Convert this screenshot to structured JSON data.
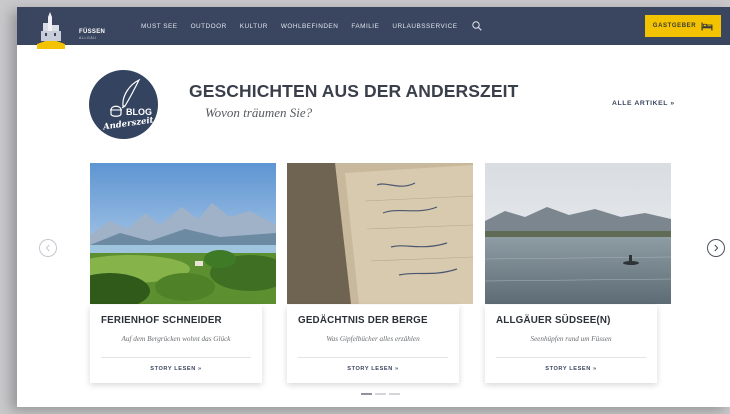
{
  "nav": {
    "logo_text": "FÜSSEN",
    "logo_sub": "ALLGÄU",
    "items": [
      "MUST SEE",
      "OUTDOOR",
      "KULTUR",
      "WOHLBEFINDEN",
      "FAMILIE",
      "URLAUBSSERVICE"
    ],
    "search_icon": "search-icon",
    "host_button": "GASTGEBER",
    "host_icon": "bed-icon"
  },
  "header": {
    "badge_word": "BLOG",
    "badge_script": "Anderszeit",
    "title": "GESCHICHTEN AUS DER ANDERSZEIT",
    "subtitle": "Wovon träumen Sie?",
    "all_articles": "ALLE ARTIKEL  »"
  },
  "cards": [
    {
      "title": "FERIENHOF SCHNEIDER",
      "description": "Auf dem Bergrücken wohnt das Glück",
      "button": "STORY LESEN  »"
    },
    {
      "title": "GEDÄCHTNIS DER BERGE",
      "description": "Was Gipfelbücher alles erzählen",
      "button": "STORY LESEN  »"
    },
    {
      "title": "ALLGÄUER SÜDSEE(N)",
      "description": "Seenhüpfen rund um Füssen",
      "button": "STORY LESEN  »"
    }
  ],
  "carousel": {
    "prev_icon": "chevron-left-icon",
    "next_icon": "chevron-right-icon",
    "pages": 3,
    "active_page": 1
  },
  "colors": {
    "nav_bg": "#3a4660",
    "accent": "#f3c200",
    "badge_bg": "#34435f"
  }
}
